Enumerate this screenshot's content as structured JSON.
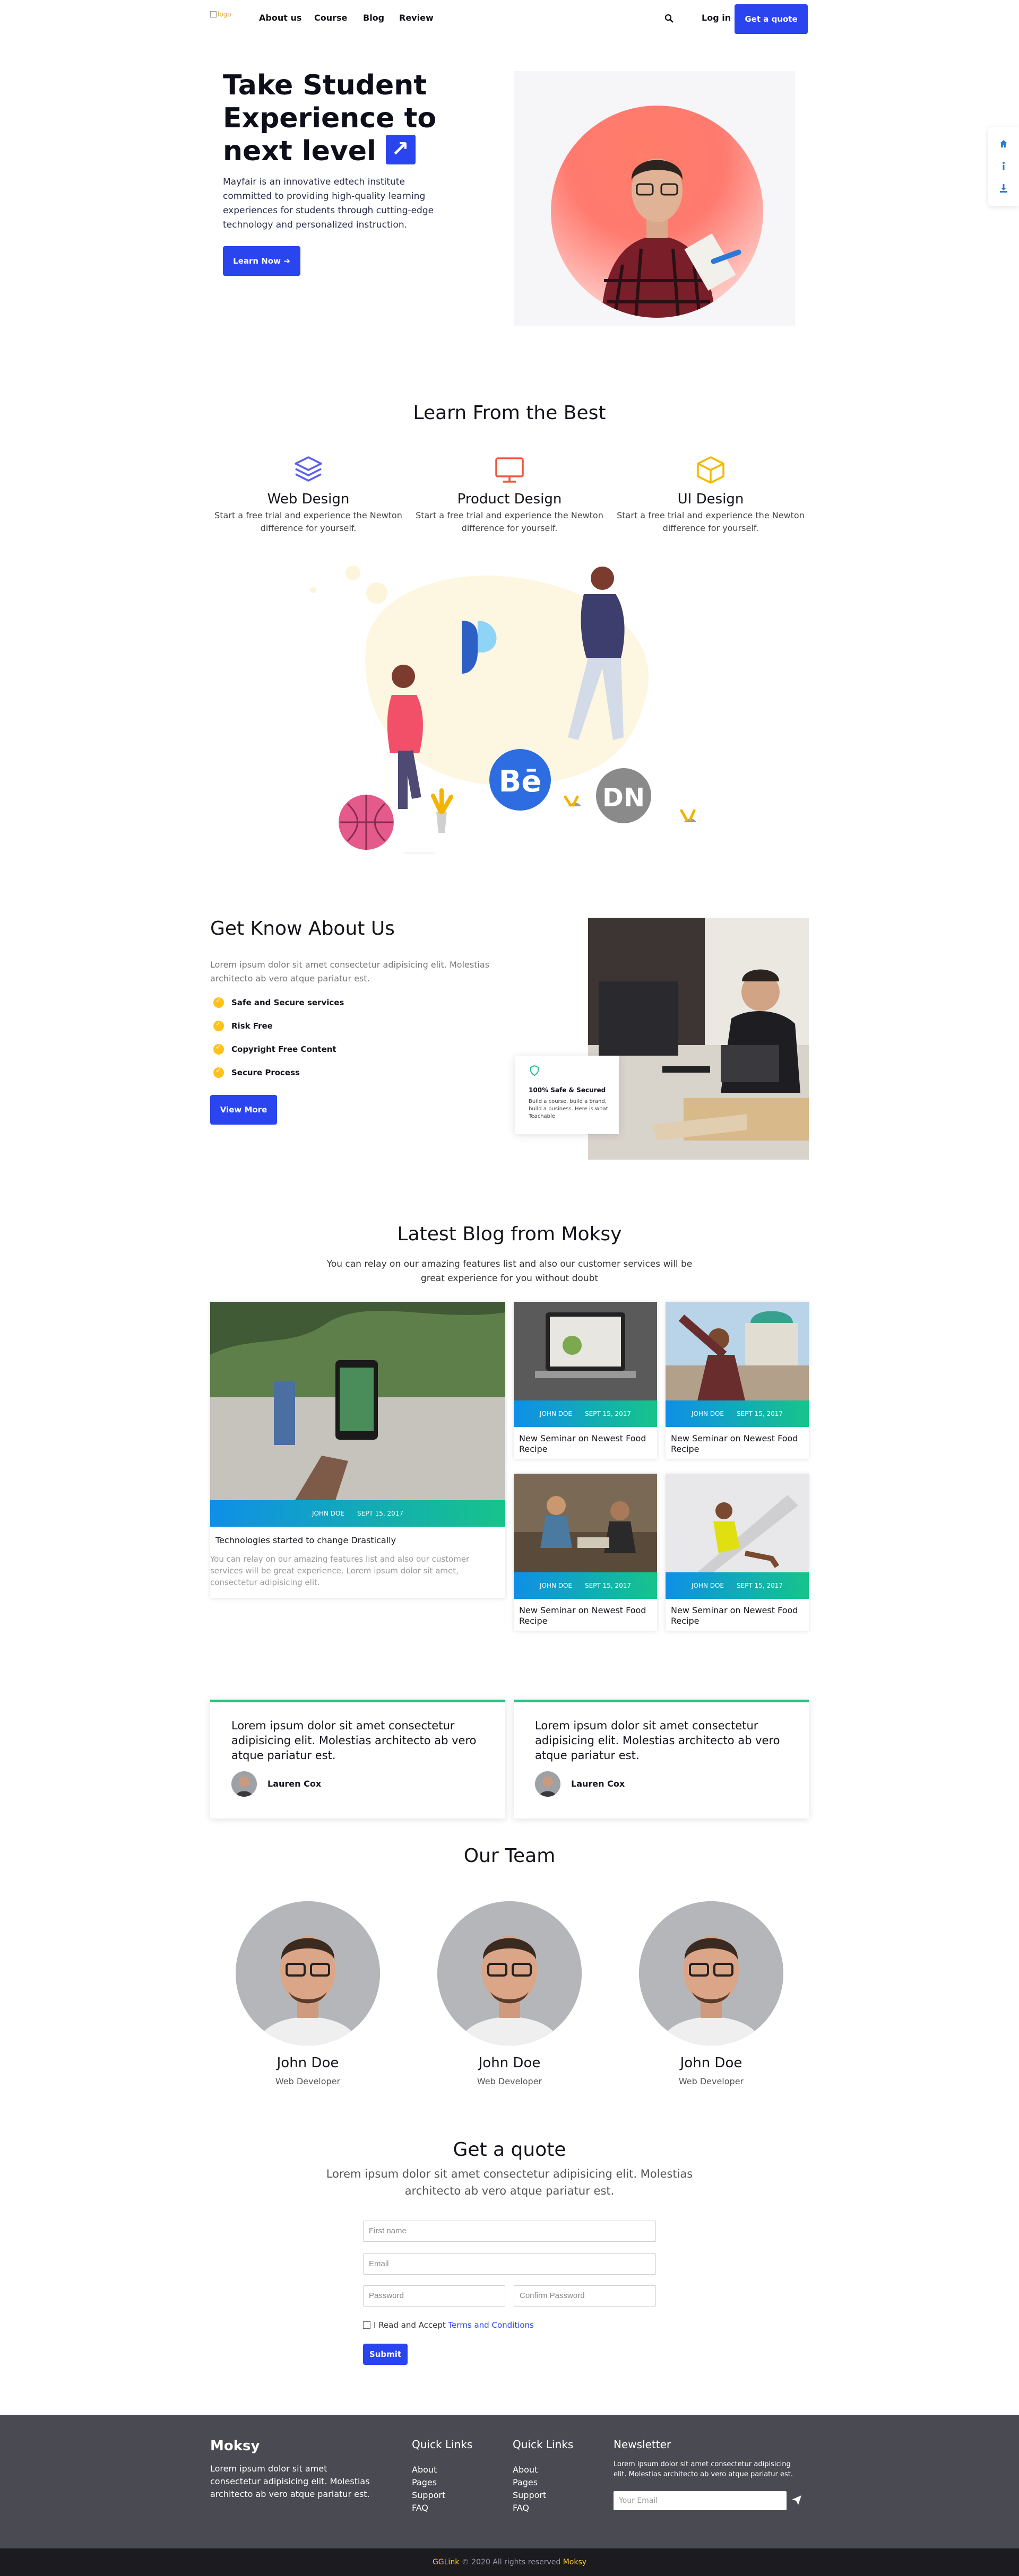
{
  "nav": {
    "logo_alt": "logo",
    "links": [
      "About us",
      "Course",
      "Blog",
      "Review"
    ],
    "login": "Log in",
    "cta": "Get a quote"
  },
  "hero": {
    "title_line1": "Take Student",
    "title_line2": "Experience to",
    "title_line3": "next level",
    "description": "Mayfair is an innovative edtech institute committed to providing high-quality learning experiences for students through cutting-edge technology and personalized instruction.",
    "button": "Learn Now"
  },
  "learn": {
    "title": "Learn From the Best",
    "features": [
      {
        "title": "Web Design",
        "text": "Start a free trial and experience the Newton difference for yourself.",
        "color": "#5b5ff0"
      },
      {
        "title": "Product Design",
        "text": "Start a free trial and experience the Newton difference for yourself.",
        "color": "#f0563a"
      },
      {
        "title": "UI Design",
        "text": "Start a free trial and experience the Newton difference for yourself.",
        "color": "#f5b800"
      }
    ],
    "illustration_labels": {
      "behance": "Bē",
      "dn": "DN"
    }
  },
  "about": {
    "title": "Get Know About Us",
    "text": "Lorem ipsum dolor sit amet consectetur adipisicing elit. Molestias architecto ab vero atque pariatur est.",
    "items": [
      "Safe and Secure services",
      "Risk Free",
      "Copyright Free Content",
      "Secure Process"
    ],
    "button": "View More",
    "card_title": "100% Safe & Secured",
    "card_text": "Build a course, build a brand, build a business. Here is what Teachable"
  },
  "blog": {
    "title": "Latest Blog from Moksy",
    "subtitle": "You can relay on our amazing features list and also our customer services will be great experience for you without doubt",
    "featured": {
      "author": "JOHN DOE",
      "date": "SEPT 15, 2017",
      "title": "Technologies started to change Drastically",
      "excerpt": "You can relay on our amazing features list and also our customer services will be great experience. Lorem ipsum dolor sit amet, consectetur adipisicing elit."
    },
    "posts": [
      {
        "author": "JOHN DOE",
        "date": "SEPT 15, 2017",
        "title": "New Seminar on Newest Food Recipe"
      },
      {
        "author": "JOHN DOE",
        "date": "SEPT 15, 2017",
        "title": "New Seminar on Newest Food Recipe"
      },
      {
        "author": "JOHN DOE",
        "date": "SEPT 15, 2017",
        "title": "New Seminar on Newest Food Recipe"
      },
      {
        "author": "JOHN DOE",
        "date": "SEPT 15, 2017",
        "title": "New Seminar on Newest Food Recipe"
      }
    ]
  },
  "testimonials": [
    {
      "text": "Lorem ipsum dolor sit amet consectetur adipisicing elit. Molestias architecto ab vero atque pariatur est.",
      "name": "Lauren Cox"
    },
    {
      "text": "Lorem ipsum dolor sit amet consectetur adipisicing elit. Molestias architecto ab vero atque pariatur est.",
      "name": "Lauren Cox"
    }
  ],
  "team": {
    "title": "Our Team",
    "members": [
      {
        "name": "John Doe",
        "role": "Web Developer"
      },
      {
        "name": "John Doe",
        "role": "Web Developer"
      },
      {
        "name": "John Doe",
        "role": "Web Developer"
      }
    ]
  },
  "quote": {
    "title": "Get a quote",
    "subtitle": "Lorem ipsum dolor sit amet consectetur adipisicing elit. Molestias architecto ab vero atque pariatur est.",
    "first_name_placeholder": "First name",
    "email_placeholder": "Email",
    "password_placeholder": "Password",
    "confirm_placeholder": "Confirm Password",
    "terms_prefix": "I Read and Accept",
    "terms_link": "Terms and Conditions",
    "submit": "Submit"
  },
  "footer": {
    "brand": "Moksy",
    "description": "Lorem ipsum dolor sit amet consectetur adipisicing elit. Molestias architecto ab vero atque pariatur est.",
    "col1_title": "Quick Links",
    "col2_title": "Quick Links",
    "links": [
      "About",
      "Pages",
      "Support",
      "FAQ"
    ],
    "newsletter_title": "Newsletter",
    "newsletter_text": "Lorem ipsum dolor sit amet consectetur adipisicing elit. Molestias architecto ab vero atque pariatur est.",
    "newsletter_placeholder": "Your Email",
    "copyright_brand": "GGLink",
    "copyright_text": "© 2020 All rights reserved",
    "copyright_end": "Moksy"
  },
  "colors": {
    "accent": "#2a44f0",
    "green": "#23c483",
    "yellow": "#ffc21a",
    "footer": "#4a4a52"
  }
}
